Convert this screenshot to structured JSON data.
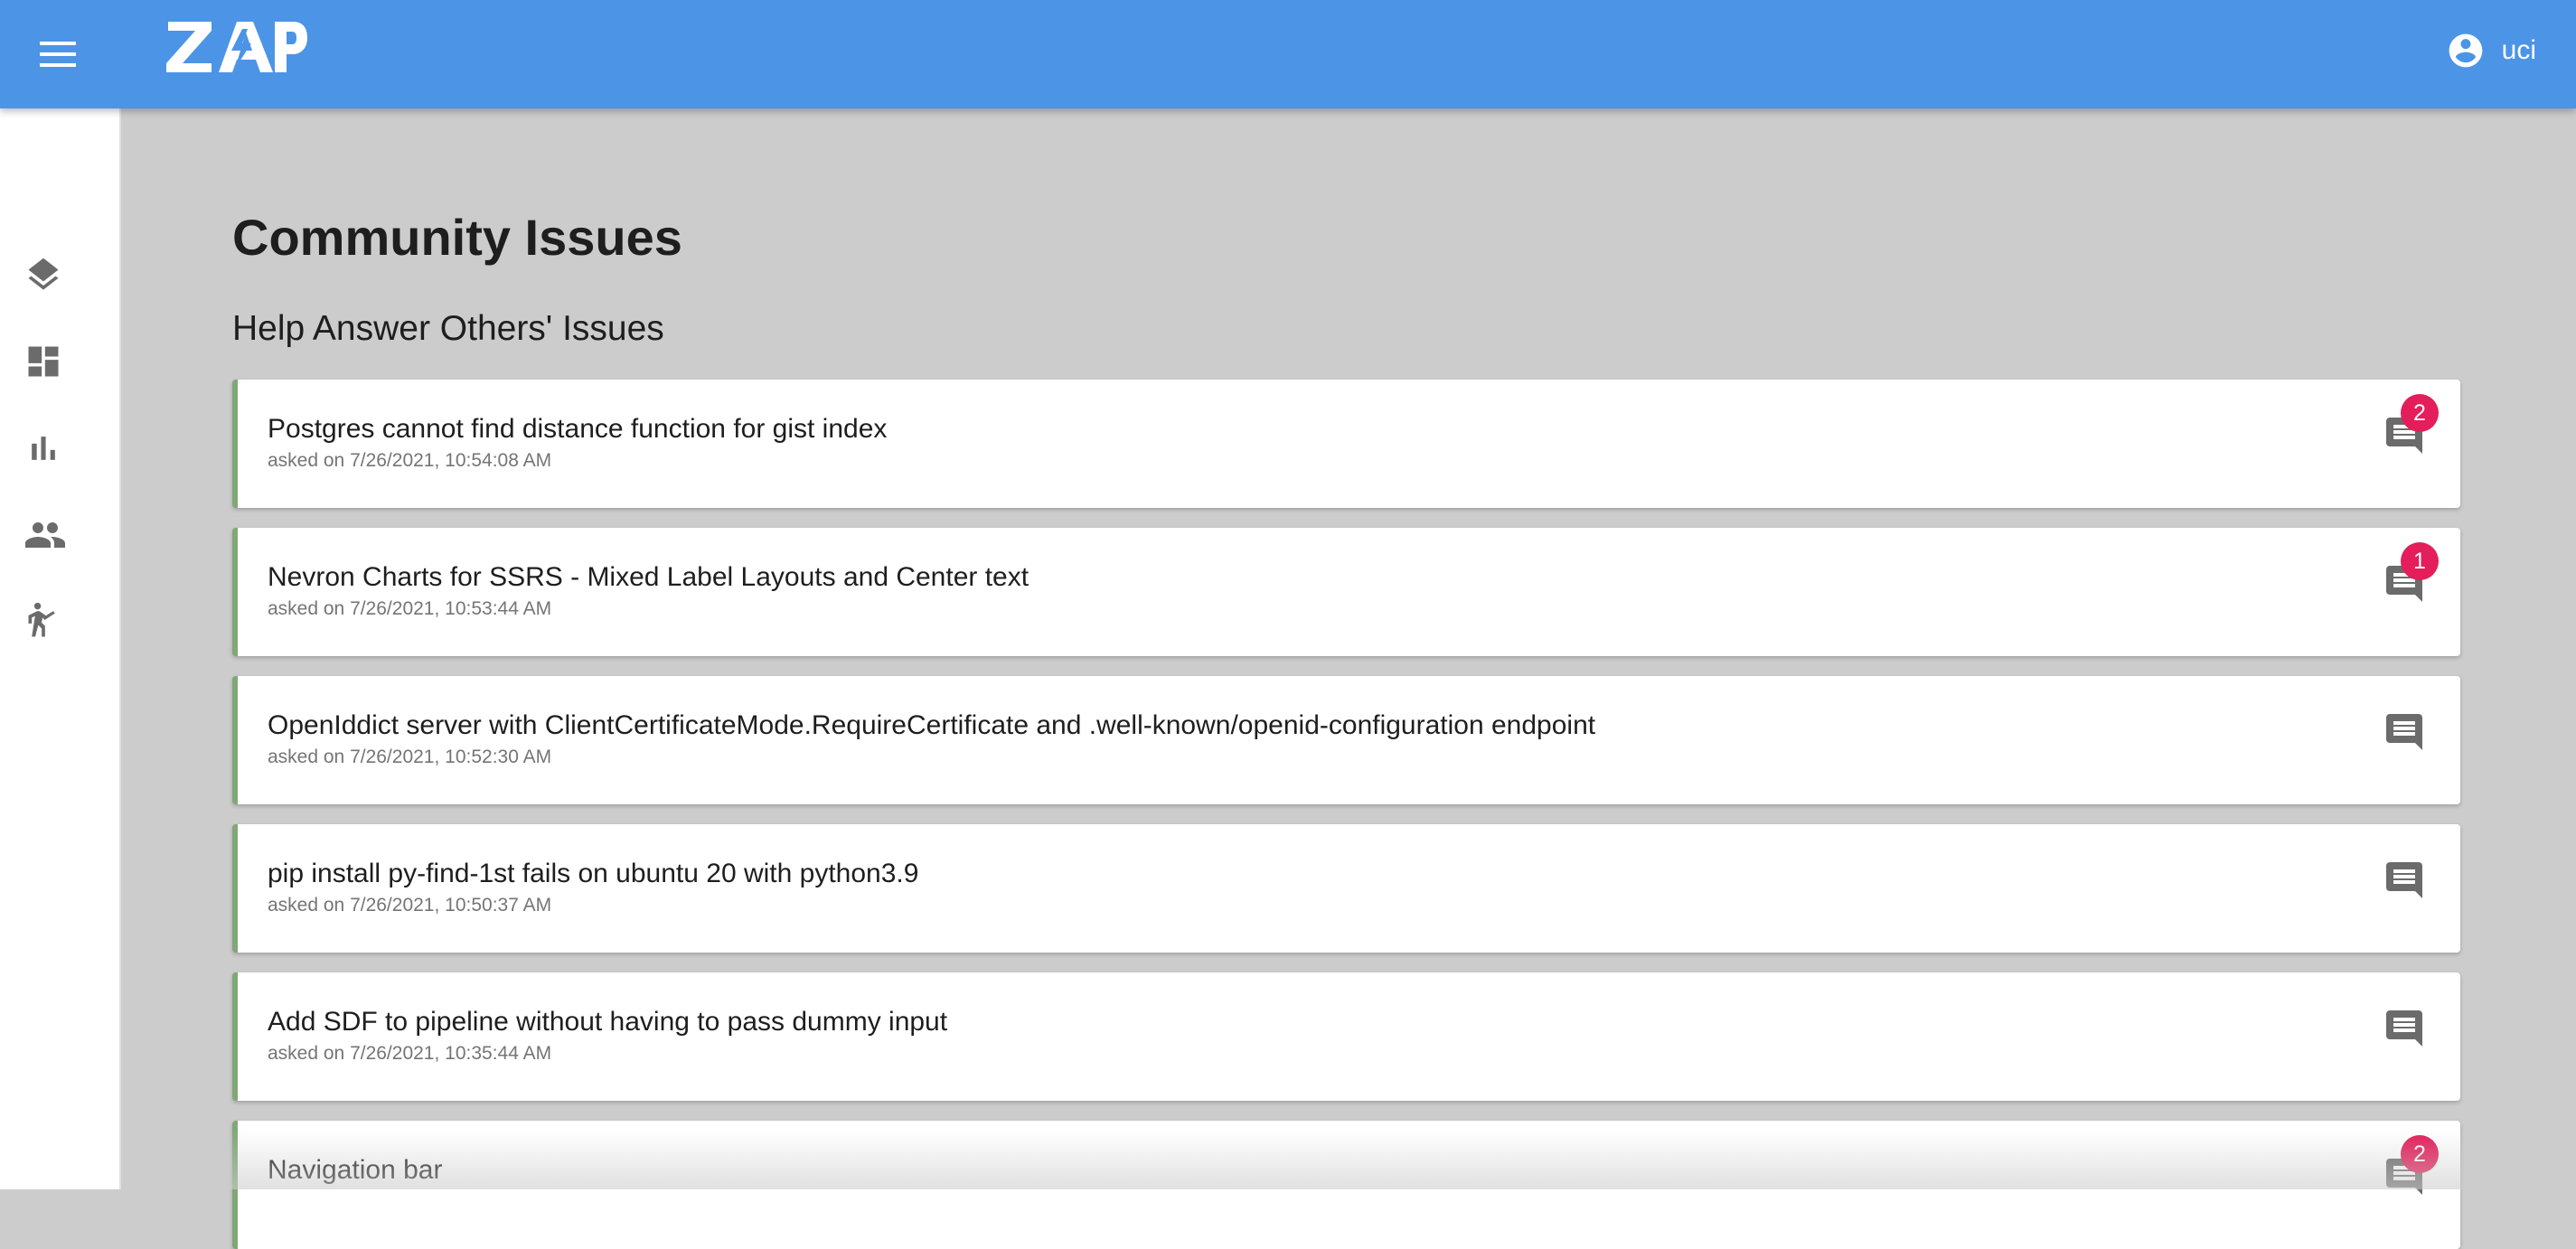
{
  "app": {
    "logo_text": "ZAP",
    "username": "uci"
  },
  "header": {
    "menu_icon": "menu-icon",
    "user_icon": "account-circle-icon"
  },
  "sidebar": {
    "items": [
      {
        "icon": "layers-icon",
        "name": "layers"
      },
      {
        "icon": "dashboard-icon",
        "name": "dashboard"
      },
      {
        "icon": "bar-chart-icon",
        "name": "statistics"
      },
      {
        "icon": "people-icon",
        "name": "community"
      },
      {
        "icon": "person-walking-icon",
        "name": "activity"
      }
    ]
  },
  "main": {
    "page_title": "Community Issues",
    "section_title": "Help Answer Others' Issues",
    "issues": [
      {
        "title": "Postgres cannot find distance function for gist index",
        "date": "asked on 7/26/2021, 10:54:08 AM",
        "comments": "2"
      },
      {
        "title": "Nevron Charts for SSRS - Mixed Label Layouts and Center text",
        "date": "asked on 7/26/2021, 10:53:44 AM",
        "comments": "1"
      },
      {
        "title": "OpenIddict server with ClientCertificateMode.RequireCertificate and .well-known/openid-configuration endpoint",
        "date": "asked on 7/26/2021, 10:52:30 AM",
        "comments": ""
      },
      {
        "title": "pip install py-find-1st fails on ubuntu 20 with python3.9",
        "date": "asked on 7/26/2021, 10:50:37 AM",
        "comments": ""
      },
      {
        "title": "Add SDF to pipeline without having to pass dummy input",
        "date": "asked on 7/26/2021, 10:35:44 AM",
        "comments": ""
      },
      {
        "title": "Navigation bar",
        "date": "",
        "comments": "2"
      }
    ]
  },
  "colors": {
    "header": "#4c94e6",
    "background": "#cccccc",
    "card_accent": "#80a877",
    "badge": "#e31e5a",
    "icon_gray": "#6b6b6b"
  }
}
